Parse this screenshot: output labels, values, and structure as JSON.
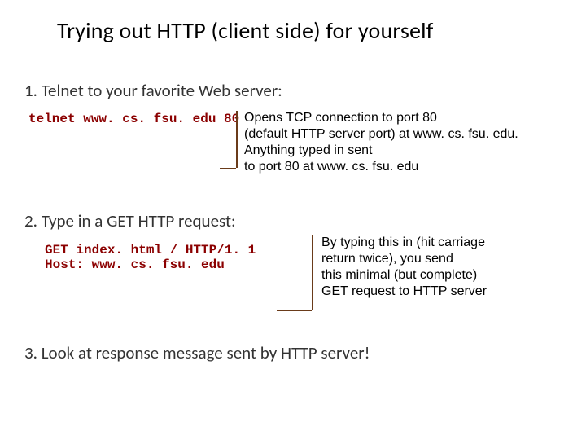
{
  "title": "Trying out HTTP (client side) for yourself",
  "steps": {
    "one": "1. Telnet to your favorite Web server:",
    "two": "2. Type in a GET HTTP request:",
    "three": "3. Look at response message sent by HTTP server!"
  },
  "code": {
    "telnet": "telnet www. cs. fsu. edu 80",
    "get": "GET index. html / HTTP/1. 1\nHost: www. cs. fsu. edu"
  },
  "notes": {
    "telnet": "Opens TCP connection to port 80\n(default HTTP server port) at www. cs. fsu. edu.\nAnything typed in sent\nto port 80 at www. cs. fsu. edu",
    "get": "By typing this in (hit carriage\nreturn twice), you send\nthis minimal (but complete)\nGET request to HTTP server"
  }
}
